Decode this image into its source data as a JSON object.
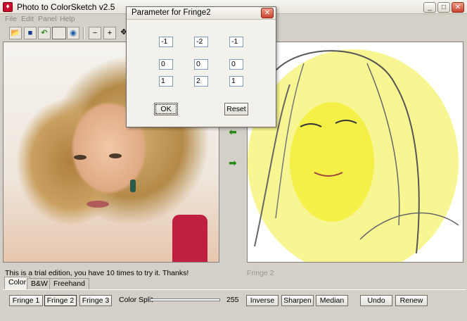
{
  "window": {
    "title": "Photo to ColorSketch v2.5"
  },
  "menu": [
    "File",
    "Edit",
    "Panel",
    "Help"
  ],
  "toolbar": [
    "open-folder-icon",
    "save-icon",
    "undo-arrow-icon",
    "color-icon",
    "zoom-out-icon",
    "zoom-in-icon",
    "move-icon"
  ],
  "right_panel": {
    "caption": "Fringe 2"
  },
  "status": {
    "text": "This is a trial edition, you have 10 times to try it. Thanks!"
  },
  "tabs": [
    {
      "label": "Color",
      "active": true
    },
    {
      "label": "B&W",
      "active": false
    },
    {
      "label": "Freehand",
      "active": false
    }
  ],
  "controls": {
    "fringe1": "Fringe 1",
    "fringe2": "Fringe 2",
    "fringe3": "Fringe 3",
    "color_split_label": "Color Split",
    "color_split_value": "255",
    "inverse": "Inverse",
    "sharpen": "Sharpen",
    "median": "Median",
    "undo": "Undo",
    "renew": "Renew"
  },
  "dialog": {
    "title": "Parameter for Fringe2",
    "kernel": [
      [
        "-1",
        "-2",
        "-1"
      ],
      [
        "0",
        "0",
        "0"
      ],
      [
        "1",
        "2",
        "1"
      ]
    ],
    "ok_label": "OK",
    "reset_label": "Reset"
  },
  "colors": {
    "sketch_yellow": "#f2ee3a",
    "close_red": "#c9442c",
    "arrow_green": "#2a8a1a"
  }
}
